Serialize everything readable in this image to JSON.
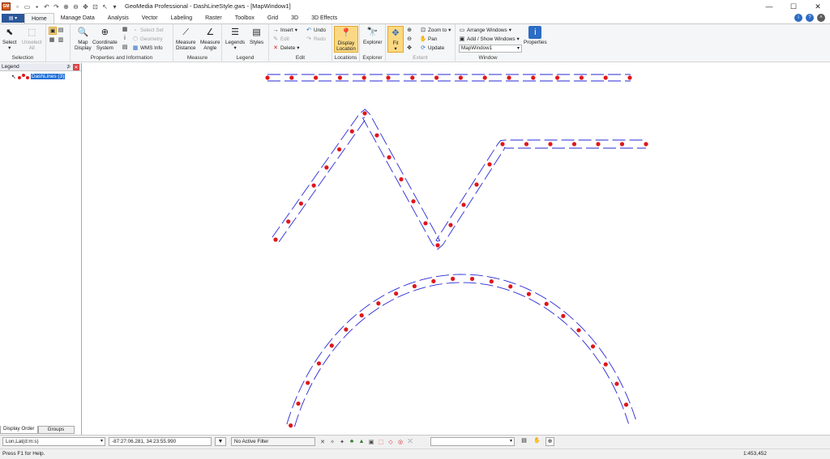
{
  "window": {
    "title": "GeoMedia Professional - DashLineStyle.gws - [MapWindow1]",
    "app_icon_text": "GM",
    "controls": [
      "—",
      "☐",
      "✕"
    ]
  },
  "ribbon_tabs": [
    "Home",
    "Manage Data",
    "Analysis",
    "Vector",
    "Labeling",
    "Raster",
    "Toolbox",
    "Grid",
    "3D",
    "3D Effects"
  ],
  "ribbon": {
    "selection": {
      "label": "Selection",
      "select": "Select",
      "unselect_line1": "Unselect",
      "unselect_line2": "All"
    },
    "props": {
      "label": "Properties and Information",
      "map_display_1": "Map",
      "map_display_2": "Display",
      "coord_1": "Coordinate",
      "coord_2": "System",
      "select_set": "Select Set",
      "geometry": "Geometry",
      "wms_info": "WMS Info"
    },
    "measure": {
      "label": "Measure",
      "distance_1": "Measure",
      "distance_2": "Distance",
      "angle_1": "Measure",
      "angle_2": "Angle"
    },
    "legend": {
      "label": "Legend",
      "legends": "Legends",
      "styles": "Styles"
    },
    "edit": {
      "label": "Edit",
      "insert": "Insert",
      "edit": "Edit",
      "delete": "Delete",
      "undo": "Undo",
      "redo": "Redo"
    },
    "locations": {
      "label": "Locations",
      "display_1": "Display",
      "display_2": "Location"
    },
    "explorer": {
      "label": "Explorer",
      "explorer": "Explorer"
    },
    "extent": {
      "label": "Extent",
      "fit": "Fit",
      "zoom_to": "Zoom to",
      "pan": "Pan",
      "update": "Update"
    },
    "window_grp": {
      "label": "Window",
      "arrange": "Arrange Windows",
      "add_show": "Add / Show Windows",
      "combo": "MapWindow1",
      "properties": "Properties"
    }
  },
  "legend": {
    "title": "Legend",
    "entry": "DashLines (3)",
    "tabs": [
      "Display Order",
      "Groups"
    ]
  },
  "status": {
    "coord_format": "Lon,Lat(d:m:s)",
    "coord_value": "-87:27:06.281, 34:23:55.990",
    "filter": "No Active Filter",
    "help": "Press F1 for Help.",
    "scale": "1:453,452"
  },
  "colors": {
    "accent": "#2b579a",
    "line": "#2a2ad6",
    "point": "#e0161b",
    "highlight": "#fbd984"
  }
}
